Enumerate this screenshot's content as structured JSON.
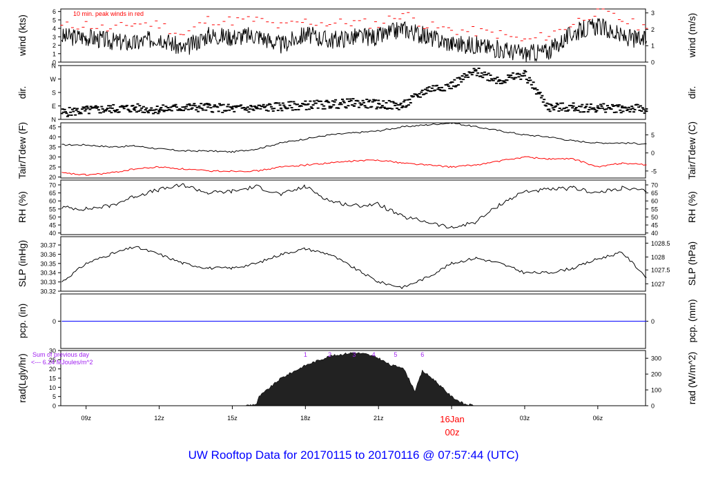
{
  "title": "UW Rooftop Data for 20170115  to  20170116 @ 07:57:44  (UTC)",
  "x_axis": {
    "start_hour": 7.96,
    "end_hour": 31.96,
    "ticks": [
      {
        "h": 9,
        "label": "09z"
      },
      {
        "h": 12,
        "label": "12z"
      },
      {
        "h": 15,
        "label": "15z"
      },
      {
        "h": 18,
        "label": "18z"
      },
      {
        "h": 21,
        "label": "21z"
      },
      {
        "h": 24,
        "label": "00z"
      },
      {
        "h": 27,
        "label": "03z"
      },
      {
        "h": 30,
        "label": "06z"
      }
    ],
    "date_label": "16Jan",
    "midnight_label": "00z",
    "date_color": "#ff0000"
  },
  "colors": {
    "line": "#000000",
    "dew": "#ff0000",
    "peak": "#ff0000",
    "pcp": "#0000ff",
    "note": "#a020f0",
    "title": "#0000ff"
  },
  "chart_data": [
    {
      "type": "line",
      "name": "wind",
      "ylabel": "wind (kts)",
      "ylabel2": "wind (m/s)",
      "ylim": [
        0,
        6.3
      ],
      "yticks": [
        0,
        1,
        2,
        3,
        4,
        5,
        6
      ],
      "y2ticks": [
        {
          "v": 0,
          "label": "0"
        },
        {
          "v": 1.944,
          "label": "1"
        },
        {
          "v": 3.888,
          "label": "2"
        },
        {
          "v": 5.832,
          "label": "3"
        }
      ],
      "annotation": "10 min. peak winds in red",
      "x": [
        8,
        9,
        10,
        11,
        12,
        13,
        14,
        15,
        16,
        17,
        18,
        19,
        20,
        21,
        22,
        23,
        24,
        25,
        26,
        27,
        28,
        29,
        30,
        31,
        32
      ],
      "values": [
        3,
        3,
        2.5,
        2.2,
        3,
        1.5,
        3.2,
        3,
        3.2,
        2,
        3.3,
        2.6,
        3,
        3,
        4,
        3,
        2.2,
        2,
        1.5,
        1,
        1.3,
        3.5,
        4.3,
        3,
        2.5
      ],
      "peaks": [
        4.2,
        4.5,
        3.8,
        4.6,
        4.5,
        3.2,
        5,
        4.9,
        5,
        4.2,
        4.8,
        4.6,
        4.7,
        4.5,
        5.8,
        4.3,
        3.8,
        3.6,
        3.3,
        2.5,
        3.2,
        4.6,
        6.1,
        5,
        4
      ]
    },
    {
      "type": "scatter",
      "name": "dir",
      "ylabel": "dir.",
      "ylabel2": "dir.",
      "ylim": [
        0,
        360
      ],
      "yticks": [
        {
          "v": 0,
          "label": "N"
        },
        {
          "v": 90,
          "label": "E"
        },
        {
          "v": 180,
          "label": "S"
        },
        {
          "v": 270,
          "label": "W"
        },
        {
          "v": 360,
          "label": "N"
        }
      ],
      "x": [
        8,
        9,
        10,
        11,
        12,
        13,
        14,
        15,
        16,
        17,
        18,
        19,
        20,
        21,
        22,
        23,
        24,
        25,
        26,
        27,
        28,
        29,
        30,
        31,
        32
      ],
      "values": [
        45,
        60,
        70,
        75,
        65,
        80,
        80,
        70,
        75,
        85,
        95,
        100,
        110,
        100,
        90,
        200,
        230,
        320,
        260,
        300,
        80,
        80,
        75,
        75,
        70
      ]
    },
    {
      "type": "line",
      "name": "temp",
      "ylabel": "Tair/Tdew (F)",
      "ylabel2": "Tair/Tdew (C)",
      "ylim": [
        19.5,
        47
      ],
      "yticks": [
        20,
        25,
        30,
        35,
        40,
        45
      ],
      "y2ticks": [
        {
          "v": 23,
          "label": "-5"
        },
        {
          "v": 32,
          "label": "0"
        },
        {
          "v": 41,
          "label": "5"
        }
      ],
      "x": [
        8,
        9,
        10,
        11,
        12,
        13,
        14,
        15,
        16,
        17,
        18,
        19,
        20,
        21,
        22,
        23,
        24,
        25,
        26,
        27,
        28,
        29,
        30,
        31,
        32
      ],
      "series": [
        {
          "name": "Tair",
          "values": [
            36,
            36,
            35,
            35.5,
            34,
            33,
            33,
            32.5,
            34,
            37,
            39,
            41,
            42,
            43,
            45,
            46,
            47,
            45,
            43,
            41,
            40,
            38,
            37,
            37,
            36.5
          ]
        },
        {
          "name": "Tdew",
          "values": [
            22,
            21,
            22,
            24,
            25,
            24,
            23,
            23,
            23,
            25,
            26,
            27,
            28,
            28.5,
            27,
            26,
            25,
            26,
            28,
            30,
            29,
            29,
            25,
            27,
            26
          ]
        }
      ]
    },
    {
      "type": "line",
      "name": "rh",
      "ylabel": "RH (%)",
      "ylabel2": "RH (%)",
      "ylim": [
        39,
        73
      ],
      "yticks": [
        40,
        45,
        50,
        55,
        60,
        65,
        70
      ],
      "y2ticks": [
        {
          "v": 40,
          "label": "40"
        },
        {
          "v": 45,
          "label": "45"
        },
        {
          "v": 50,
          "label": "50"
        },
        {
          "v": 55,
          "label": "55"
        },
        {
          "v": 60,
          "label": "60"
        },
        {
          "v": 65,
          "label": "65"
        },
        {
          "v": 70,
          "label": "70"
        }
      ],
      "x": [
        8,
        9,
        10,
        11,
        12,
        13,
        14,
        15,
        16,
        17,
        18,
        19,
        20,
        21,
        22,
        23,
        24,
        25,
        26,
        27,
        28,
        29,
        30,
        31,
        32
      ],
      "values": [
        56,
        55,
        57,
        63,
        67,
        70,
        65,
        66,
        69,
        64,
        69,
        60,
        57,
        58,
        50,
        47,
        43,
        47,
        58,
        66,
        67,
        68,
        65,
        68,
        66
      ]
    },
    {
      "type": "line",
      "name": "slp",
      "ylabel": "SLP (inHg)",
      "ylabel2": "SLP (hPa)",
      "ylim": [
        30.32,
        30.379
      ],
      "yticks": [
        30.32,
        30.33,
        30.34,
        30.35,
        30.36,
        30.37
      ],
      "y2ticks": [
        {
          "v": 30.328,
          "label": "1027"
        },
        {
          "v": 30.343,
          "label": "1027.5"
        },
        {
          "v": 30.357,
          "label": "1028"
        },
        {
          "v": 30.372,
          "label": "1028.5"
        }
      ],
      "x": [
        8,
        9,
        10,
        11,
        12,
        13,
        14,
        15,
        16,
        17,
        18,
        19,
        20,
        21,
        22,
        23,
        24,
        25,
        26,
        27,
        28,
        29,
        30,
        31,
        32
      ],
      "values": [
        30.33,
        30.35,
        30.36,
        30.368,
        30.36,
        30.35,
        30.345,
        30.345,
        30.35,
        30.36,
        30.366,
        30.36,
        30.345,
        30.33,
        30.324,
        30.335,
        30.35,
        30.356,
        30.35,
        30.34,
        30.34,
        30.345,
        30.355,
        30.362,
        30.335
      ]
    },
    {
      "type": "line",
      "name": "pcp",
      "ylabel": "pcp. (in)",
      "ylabel2": "pcp. (mm)",
      "ylim": [
        -1,
        1
      ],
      "yticks": [
        0
      ],
      "y2ticks": [
        {
          "v": 0,
          "label": "0"
        }
      ],
      "x": [
        8,
        32
      ],
      "values": [
        0,
        0
      ]
    },
    {
      "type": "area",
      "name": "rad",
      "ylabel": "rad(Lgly/hr)",
      "ylabel2": "rad (W/m^2)",
      "ylim": [
        0,
        30
      ],
      "yticks": [
        0,
        5,
        10,
        15,
        20,
        25,
        30
      ],
      "y2ticks": [
        {
          "v": 0,
          "label": "0"
        },
        {
          "v": 8.6,
          "label": "100"
        },
        {
          "v": 17.2,
          "label": "200"
        },
        {
          "v": 25.8,
          "label": "300"
        }
      ],
      "note_line1": "Sum of previous day",
      "note_line2": "<--- 6.24 MJoules/m^2",
      "hour_marks": [
        {
          "h": 18,
          "label": "1"
        },
        {
          "h": 19,
          "label": "2"
        },
        {
          "h": 20,
          "label": "3"
        },
        {
          "h": 20.8,
          "label": "4"
        },
        {
          "h": 21.7,
          "label": "5"
        },
        {
          "h": 22.8,
          "label": "6"
        }
      ],
      "x": [
        15.5,
        16,
        16.1,
        17,
        18,
        19,
        20,
        20.5,
        21,
        21.5,
        22,
        22.5,
        22.8,
        23,
        23.3,
        23.6,
        24,
        24.5,
        25
      ],
      "values": [
        0,
        1,
        5,
        15,
        22,
        27,
        29,
        28,
        26,
        22,
        21,
        8,
        19,
        17,
        14,
        10,
        5,
        1,
        0
      ]
    }
  ]
}
